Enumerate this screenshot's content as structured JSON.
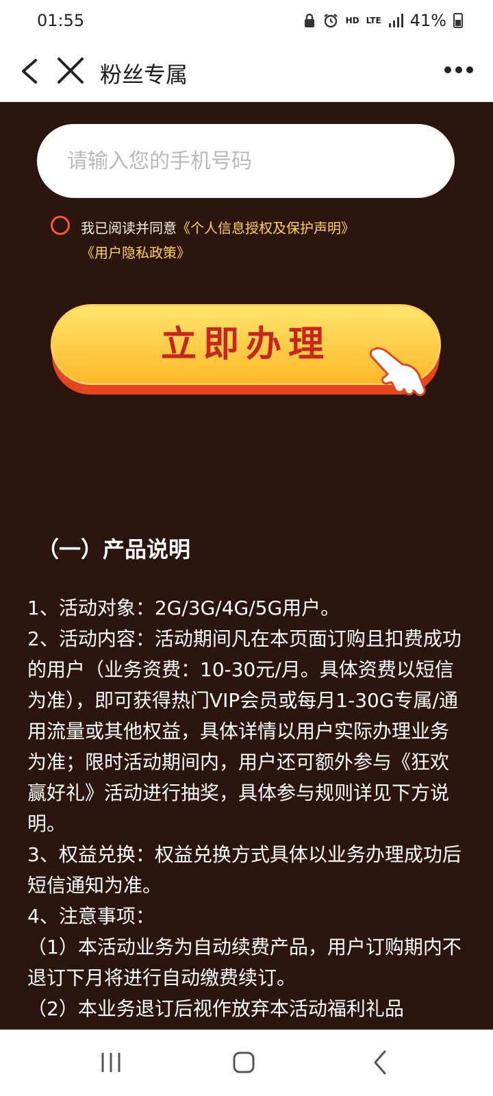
{
  "status_bar": {
    "time": "01:55",
    "hd_label": "HD",
    "lte_label": "LTE",
    "battery_text": "41%"
  },
  "app_bar": {
    "title": "粉丝专属"
  },
  "form": {
    "phone_placeholder": "请输入您的手机号码",
    "agreement_prefix": "我已阅读并同意",
    "agreement_link_1": "《个人信息授权及保护声明》",
    "agreement_link_2": "《用户隐私政策》",
    "submit_label": "立即办理"
  },
  "product": {
    "section_title": "（一）产品说明",
    "paragraphs": [
      "1、活动对象：2G/3G/4G/5G用户。",
      "2、活动内容：活动期间凡在本页面订购且扣费成功的用户（业务资费：10-30元/月。具体资费以短信为准），即可获得热门VIP会员或每月1-30G专属/通用流量或其他权益，具体详情以用户实际办理业务为准；限时活动期间内，用户还可额外参与《狂欢赢好礼》活动进行抽奖，具体参与规则详见下方说明。",
      "3、权益兑换：权益兑换方式具体以业务办理成功后短信通知为准。",
      "4、注意事项：",
      "（1）本活动业务为自动续费产品，用户订购期内不退订下月将进行自动缴费续订。",
      "（2）本业务退订后视作放弃本活动福利礼品"
    ]
  },
  "colors": {
    "background": "#2d150f",
    "link": "#ffd24a",
    "button_text": "#c8251f",
    "radio": "#ff5a2c"
  }
}
